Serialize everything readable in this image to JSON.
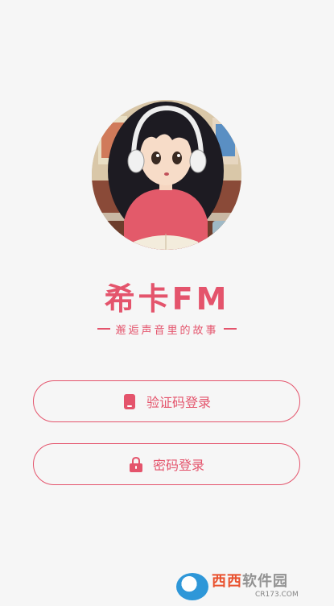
{
  "app": {
    "brand_name": "希卡FM",
    "slogan": "邂逅声音里的故事"
  },
  "buttons": {
    "sms_login_label": "验证码登录",
    "password_login_label": "密码登录"
  },
  "icons": {
    "sms_login": "phone-icon",
    "password_login": "lock-icon"
  },
  "colors": {
    "accent": "#e4546c",
    "background": "#f6f6f6"
  },
  "watermark": {
    "text_left": "西西",
    "text_right": "软件园",
    "url": "CR173.COM"
  }
}
